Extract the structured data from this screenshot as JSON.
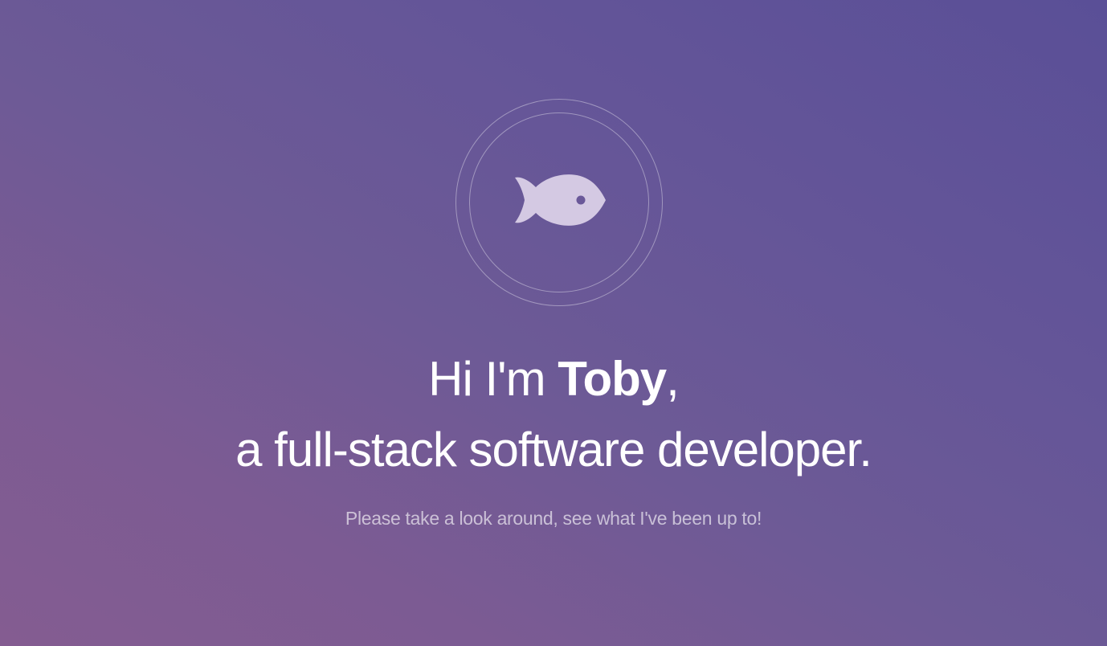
{
  "hero": {
    "logo_icon": "fish-icon",
    "headline": {
      "line1_prefix": "Hi I'm ",
      "name": "Toby",
      "line1_suffix": ",",
      "line2": "a full-stack software developer."
    },
    "subtitle": "Please take a look around, see what I've been up to!"
  },
  "colors": {
    "background_start": "#5a4f97",
    "background_end": "#845c91",
    "icon_fill": "#d4c9e3",
    "text": "#ffffff"
  }
}
